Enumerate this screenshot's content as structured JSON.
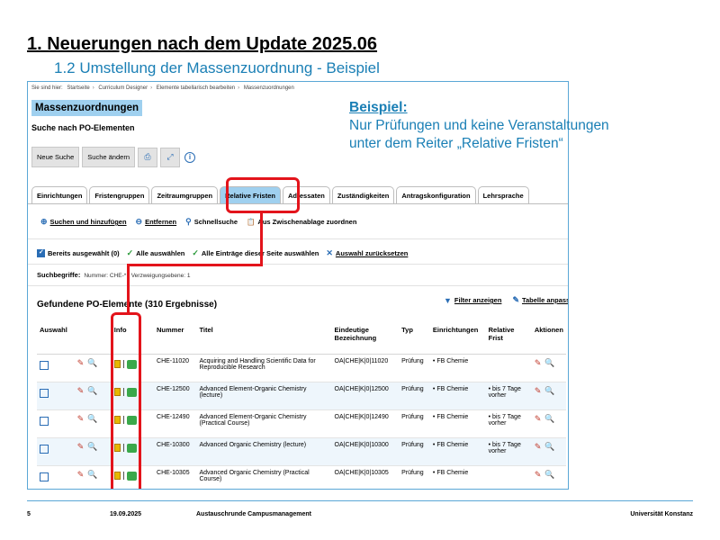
{
  "slide": {
    "title": "1. Neuerungen nach dem Update 2025.06",
    "subtitle": "1.2 Umstellung der Massenzuordnung - Beispiel"
  },
  "breadcrumb": {
    "prefix": "Sie sind hier:",
    "items": [
      "Startseite",
      "Curriculum Designer",
      "Elemente tabellarisch bearbeiten",
      "Massenzuordnungen"
    ]
  },
  "page": {
    "header": "Massenzuordnungen",
    "subheader": "Suche nach PO-Elementen"
  },
  "toolbar": {
    "new_search": "Neue Suche",
    "change_search": "Suche ändern"
  },
  "tabs": [
    {
      "label": "Einrichtungen",
      "active": false
    },
    {
      "label": "Fristengruppen",
      "active": false
    },
    {
      "label": "Zeitraumgruppen",
      "active": false
    },
    {
      "label": "Relative Fristen",
      "active": true
    },
    {
      "label": "Adressaten",
      "active": false
    },
    {
      "label": "Zuständigkeiten",
      "active": false
    },
    {
      "label": "Antragskonfiguration",
      "active": false
    },
    {
      "label": "Lehrsprache",
      "active": false
    }
  ],
  "actions": {
    "search_add": "Suchen und hinzufügen",
    "remove": "Entfernen",
    "quick_search": "Schnellsuche",
    "clipboard": "Aus Zwischenablage zuordnen",
    "already_selected": "Bereits ausgewählt (0)",
    "select_all": "Alle auswählen",
    "select_page": "Alle Einträge dieser Seite auswählen",
    "reset": "Auswahl zurücksetzen"
  },
  "search_terms": {
    "label": "Suchbegriffe:",
    "value": "Nummer: CHE-* ; Verzweigungsebene: 1"
  },
  "results": {
    "title": "Gefundene PO-Elemente (310 Ergebnisse)",
    "show_filter": "Filter anzeigen",
    "adjust_table": "Tabelle anpassen"
  },
  "table": {
    "headers": {
      "select": "Auswahl",
      "info": "Info",
      "number": "Nummer",
      "title": "Titel",
      "unique": "Eindeutige Bezeichnung",
      "type": "Typ",
      "institutions": "Einrichtungen",
      "relative": "Relative Frist",
      "actions": "Aktionen"
    },
    "rows": [
      {
        "number": "CHE-11020",
        "title": "Acquiring and Handling Scientific Data for Reproducible Research",
        "unique": "OA|CHE|K|0|11020",
        "type": "Prüfung",
        "inst": "FB Chemie",
        "relative": "",
        "badge": "1"
      },
      {
        "number": "CHE-12500",
        "title": "Advanced Element-Organic Chemistry (lecture)",
        "unique": "OA|CHE|K|0|12500",
        "type": "Prüfung",
        "inst": "FB Chemie",
        "relative": "bis 7 Tage vorher",
        "badge": "38"
      },
      {
        "number": "CHE-12490",
        "title": "Advanced Element-Organic Chemistry (Practical Course)",
        "unique": "OA|CHE|K|0|12490",
        "type": "Prüfung",
        "inst": "FB Chemie",
        "relative": "bis 7 Tage vorher",
        "badge": "37"
      },
      {
        "number": "CHE-10300",
        "title": "Advanced Organic Chemistry (lecture)",
        "unique": "OA|CHE|K|0|10300",
        "type": "Prüfung",
        "inst": "FB Chemie",
        "relative": "bis 7 Tage vorher",
        "badge": "37"
      },
      {
        "number": "CHE-10305",
        "title": "Advanced Organic Chemistry (Practical Course)",
        "unique": "OA|CHE|K|0|10305",
        "type": "Prüfung",
        "inst": "FB Chemie",
        "relative": "",
        "badge": "37"
      }
    ]
  },
  "example": {
    "heading": "Beispiel:",
    "line1": "Nur Prüfungen und keine Veranstaltungen",
    "line2": "unter dem Reiter „Relative Fristen“"
  },
  "footer": {
    "page": "5",
    "date": "19.09.2025",
    "event": "Austauschrunde Campusmanagement",
    "org": "Universität Konstanz"
  },
  "colors": {
    "accent": "#1a7fb5",
    "highlight": "#e3141b",
    "header_bg": "#9fd0ef"
  }
}
